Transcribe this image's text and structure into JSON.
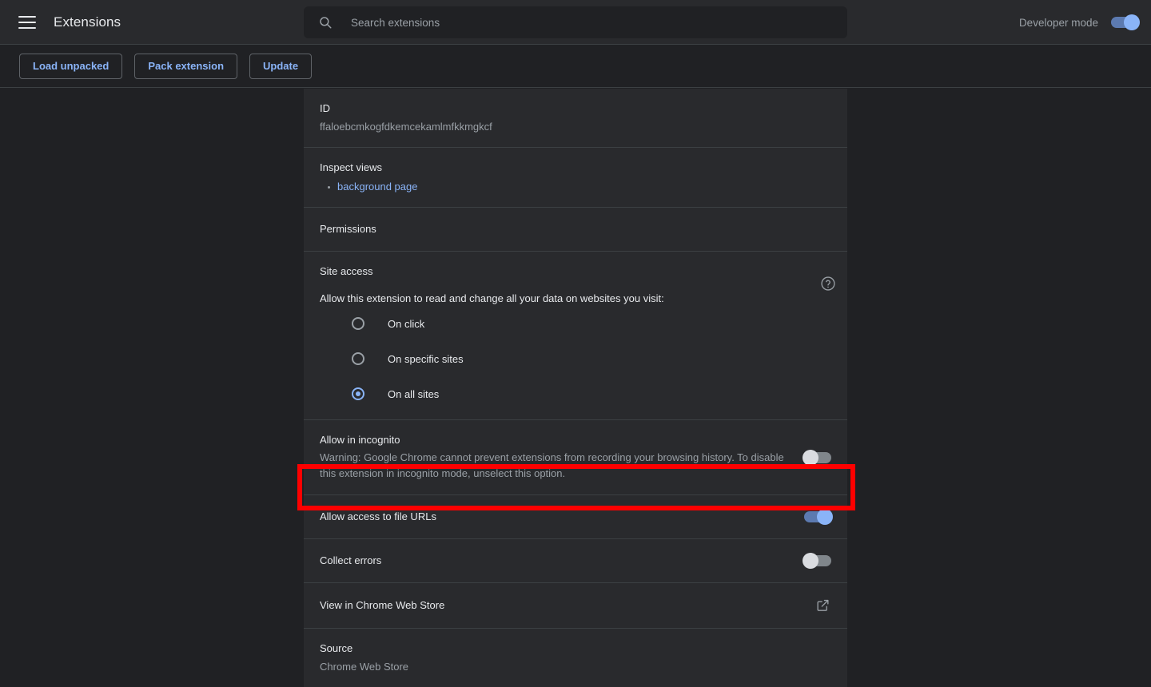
{
  "header": {
    "menu_icon": "hamburger-menu-icon",
    "title": "Extensions",
    "search": {
      "icon": "search-icon",
      "placeholder": "Search extensions",
      "value": ""
    },
    "developer_mode": {
      "label": "Developer mode",
      "state": "on"
    }
  },
  "toolbar": {
    "buttons": [
      {
        "label": "Load unpacked"
      },
      {
        "label": "Pack extension"
      },
      {
        "label": "Update"
      }
    ]
  },
  "detail": {
    "id": {
      "title": "ID",
      "value": "ffaloebcmkogfdkemcekamlmfkkmgkcf"
    },
    "inspect_views": {
      "title": "Inspect views",
      "items": [
        {
          "label": "background page"
        }
      ]
    },
    "permissions": {
      "title": "Permissions"
    },
    "site_access": {
      "title": "Site access",
      "description": "Allow this extension to read and change all your data on websites you visit:",
      "help_icon": "help-circle-icon",
      "options": [
        {
          "label": "On click",
          "selected": false
        },
        {
          "label": "On specific sites",
          "selected": false
        },
        {
          "label": "On all sites",
          "selected": true
        }
      ]
    },
    "allow_incognito": {
      "title": "Allow in incognito",
      "warning": "Warning: Google Chrome cannot prevent extensions from recording your browsing history. To disable this extension in incognito mode, unselect this option.",
      "state": "off"
    },
    "allow_file_urls": {
      "title": "Allow access to file URLs",
      "state": "on",
      "highlighted": true
    },
    "collect_errors": {
      "title": "Collect errors",
      "state": "off"
    },
    "web_store": {
      "title": "View in Chrome Web Store",
      "icon": "open-in-new-icon"
    },
    "source": {
      "title": "Source",
      "value": "Chrome Web Store"
    }
  },
  "annotation": {
    "color": "#fe0000",
    "target": "allow-access-to-file-urls-row"
  },
  "colors": {
    "page_background": "#202124",
    "card_background": "#292a2d",
    "accent_blue": "#8ab4f8",
    "text_primary": "#e8eaed",
    "text_secondary": "#9aa0a6",
    "divider": "#3c4043"
  }
}
